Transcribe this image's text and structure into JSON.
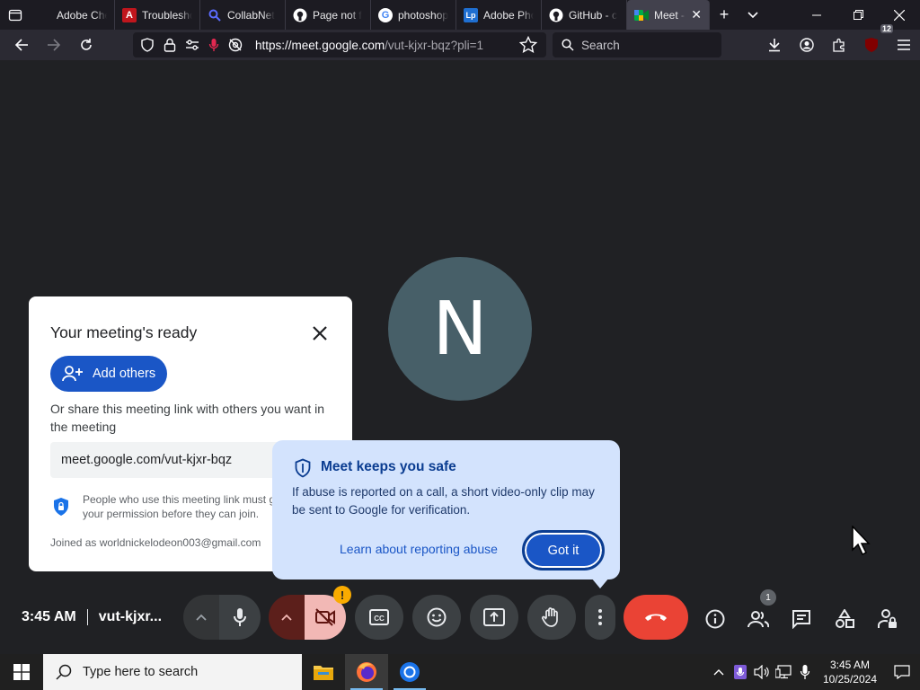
{
  "browser": {
    "tabs": [
      {
        "label": "Adobe Checko",
        "favicon": "firefox-view-icon"
      },
      {
        "label": "Troublesho",
        "favicon": "adobe-icon"
      },
      {
        "label": "CollabNet",
        "favicon": "search-icon"
      },
      {
        "label": "Page not f",
        "favicon": "github-icon"
      },
      {
        "label": "photoshop",
        "favicon": "google-icon"
      },
      {
        "label": "Adobe Pho",
        "favicon": "lp-icon"
      },
      {
        "label": "GitHub - c",
        "favicon": "github-icon"
      },
      {
        "label": "Meet - v",
        "favicon": "meet-icon",
        "active": true
      }
    ],
    "url_host": "https://meet.google.com",
    "url_path": "/vut-kjxr-bqz?pli=1",
    "search_placeholder": "Search",
    "extension_badge": "12"
  },
  "meet": {
    "avatar_initial": "N",
    "ready_card": {
      "title": "Your meeting's ready",
      "add_others_label": "Add others",
      "share_text": "Or share this meeting link with others you want in the meeting",
      "meeting_link": "meet.google.com/vut-kjxr-bqz",
      "permission_text": "People who use this meeting link must get your permission before they can join.",
      "joined_as": "Joined as worldnickelodeon003@gmail.com"
    },
    "safe_popup": {
      "title": "Meet keeps you safe",
      "body": "If abuse is reported on a call, a short video-only clip may be sent to Google for verification.",
      "learn_link": "Learn about reporting abuse",
      "got_it_label": "Got it"
    },
    "controls": {
      "time": "3:45 AM",
      "meeting_code": "vut-kjxr...",
      "people_count": "1",
      "camera_warning": "!"
    }
  },
  "taskbar": {
    "search_placeholder": "Type here to search",
    "clock_time": "3:45 AM",
    "clock_date": "10/25/2024"
  },
  "colors": {
    "meet_bg": "#202124",
    "accent_blue": "#1a56c6",
    "hangup_red": "#ea4335",
    "popup_bg": "#d3e3fd"
  }
}
